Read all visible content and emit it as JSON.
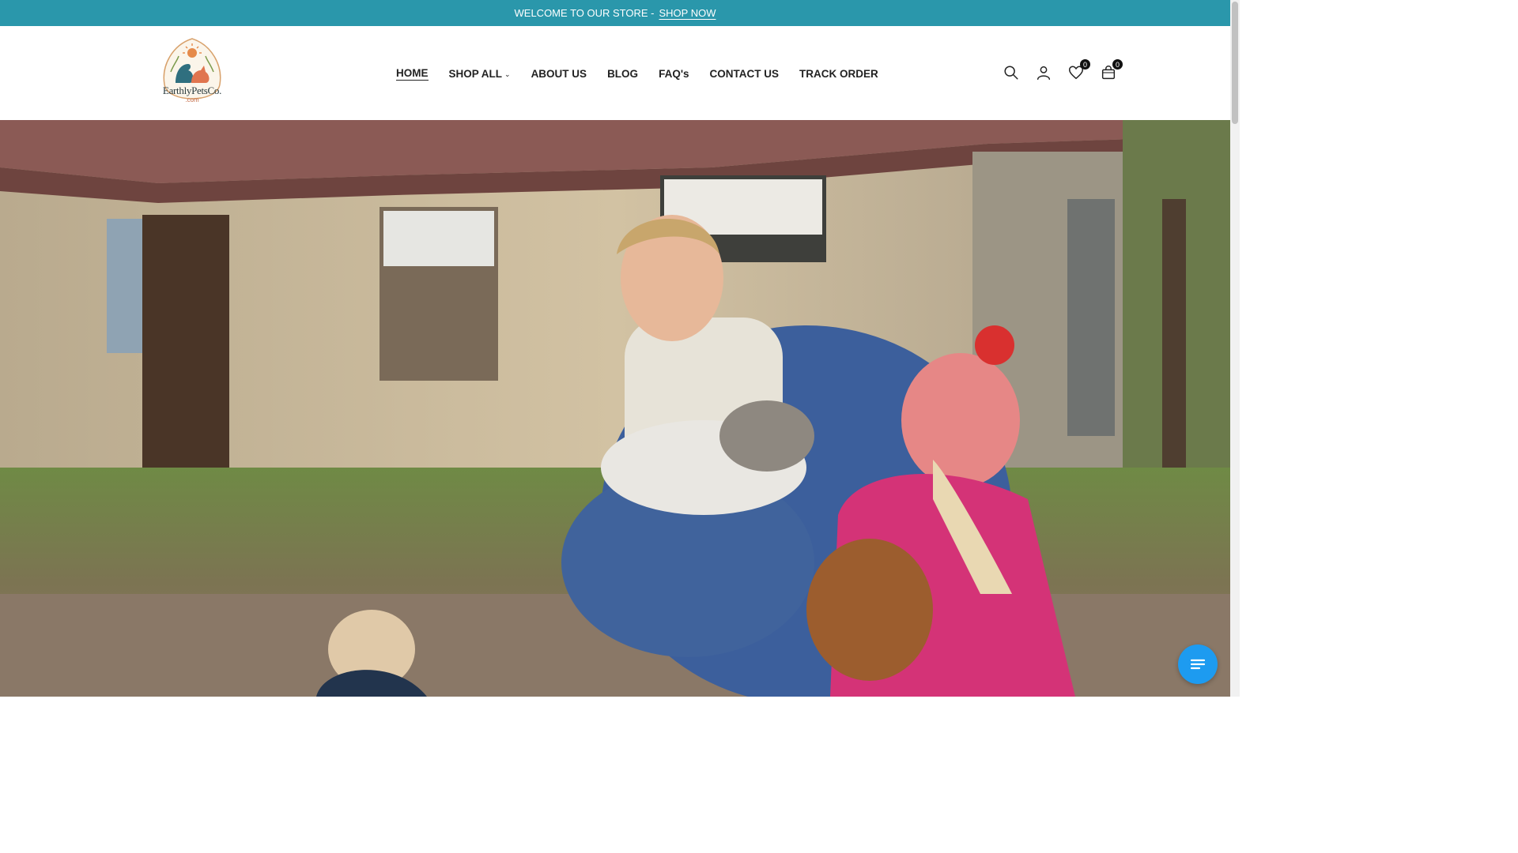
{
  "announcement": {
    "text": "WELCOME TO OUR STORE -",
    "link": "SHOP NOW"
  },
  "logo": {
    "name": "EarthlyPetsCo.",
    "sub": ".com"
  },
  "nav": {
    "items": [
      {
        "label": "HOME",
        "active": true
      },
      {
        "label": "SHOP ALL",
        "dropdown": true
      },
      {
        "label": "ABOUT US"
      },
      {
        "label": "BLOG"
      },
      {
        "label": "FAQ's"
      },
      {
        "label": "CONTACT US"
      },
      {
        "label": "TRACK ORDER"
      }
    ]
  },
  "header_icons": {
    "wishlist_count": "0",
    "cart_count": "0"
  },
  "colors": {
    "announcement_bg": "#2a97ab",
    "chat_button": "#1d9bf0"
  },
  "icons": [
    "search-icon",
    "account-icon",
    "heart-icon",
    "cart-icon",
    "chat-menu-icon"
  ]
}
